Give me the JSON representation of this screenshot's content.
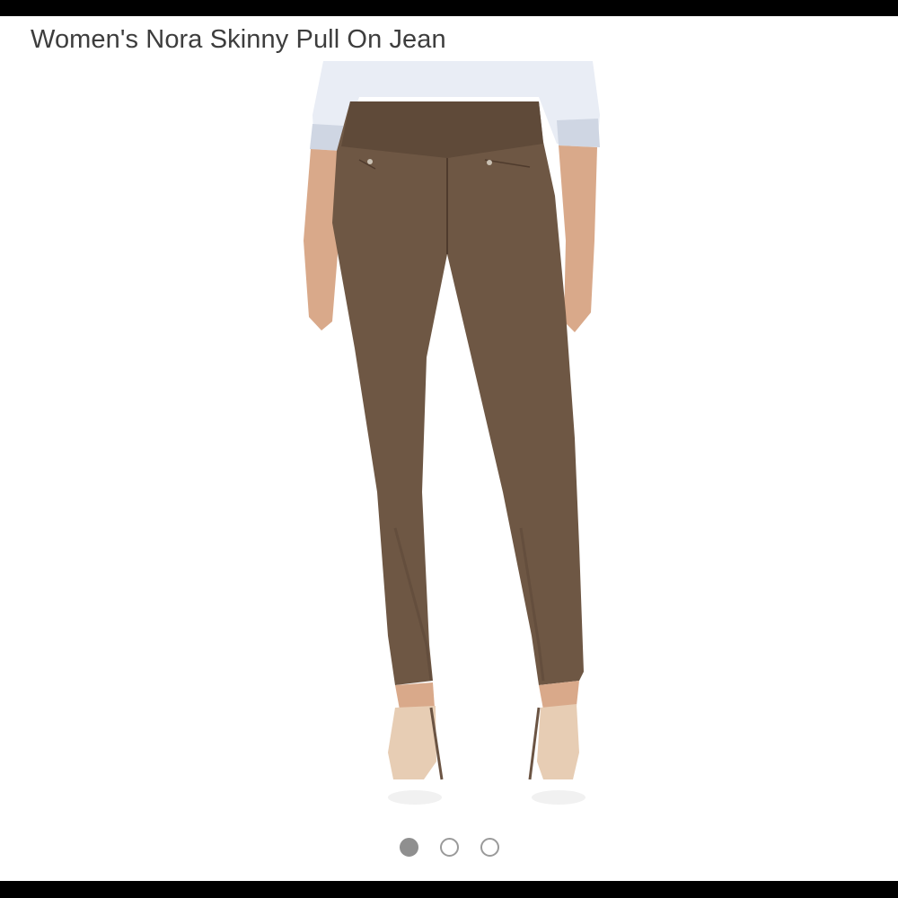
{
  "product": {
    "title": "Women's Nora Skinny Pull On Jean"
  },
  "image": {
    "subject": "product-photo",
    "colors": {
      "pants": "#6e5744",
      "pants_shadow": "#5a4535",
      "shirt": "#e9edf5",
      "skin": "#d9a98a",
      "shoes": "#e7cdb4"
    }
  },
  "carousel": {
    "total": 3,
    "active_index": 0,
    "colors": {
      "active": "#8f8f8f",
      "inactive_border": "#9a9a9a"
    }
  }
}
